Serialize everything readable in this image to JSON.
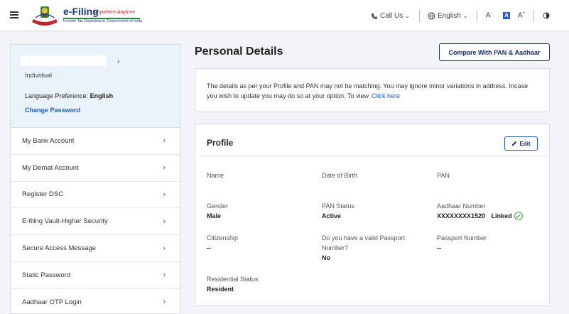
{
  "header": {
    "logo_title": "e-Filing",
    "logo_tagline": "Anywhere Anytime",
    "logo_subtitle": "Income Tax Department, Government of India",
    "call_us": "Call Us",
    "language": "English",
    "font_decrease": "A",
    "font_normal": "A",
    "font_increase": "A"
  },
  "sidebar": {
    "user_type": "Individual",
    "language_pref_label": "Language Preference:",
    "language_pref_value": "English",
    "change_password": "Change Password",
    "items": [
      {
        "label": "My Bank Account"
      },
      {
        "label": "My Demat Account"
      },
      {
        "label": "Register DSC"
      },
      {
        "label": "E-filing Vault-Higher Security"
      },
      {
        "label": "Secure Access Message"
      },
      {
        "label": "Static Password"
      },
      {
        "label": "Aadhaar OTP Login"
      }
    ]
  },
  "main": {
    "title": "Personal Details",
    "compare_button": "Compare With PAN & Aadhaar",
    "notice_text": "The details as per your Profile and PAN may not be matching. You may ignore minor variations in address. Incase you wish to update you may do so at your option. To view",
    "notice_link": "Click here",
    "profile": {
      "title": "Profile",
      "edit_button": "Edit",
      "name_label": "Name",
      "dob_label": "Date of Birth",
      "pan_label": "PAN",
      "gender_label": "Gender",
      "gender_value": "Male",
      "pan_status_label": "PAN Status",
      "pan_status_value": "Active",
      "aadhaar_label": "Aadhaar Number",
      "aadhaar_value": "XXXXXXXX1520",
      "aadhaar_status": "Linked",
      "citizenship_label": "Citizenship",
      "citizenship_value": "--",
      "passport_q_line1": "Do you have a valid Passport",
      "passport_q_line2": "Number?",
      "passport_q_value": "No",
      "passport_label": "Passport Number",
      "passport_value": "--",
      "residential_label": "Residential Status",
      "residential_value": "Resident"
    }
  }
}
